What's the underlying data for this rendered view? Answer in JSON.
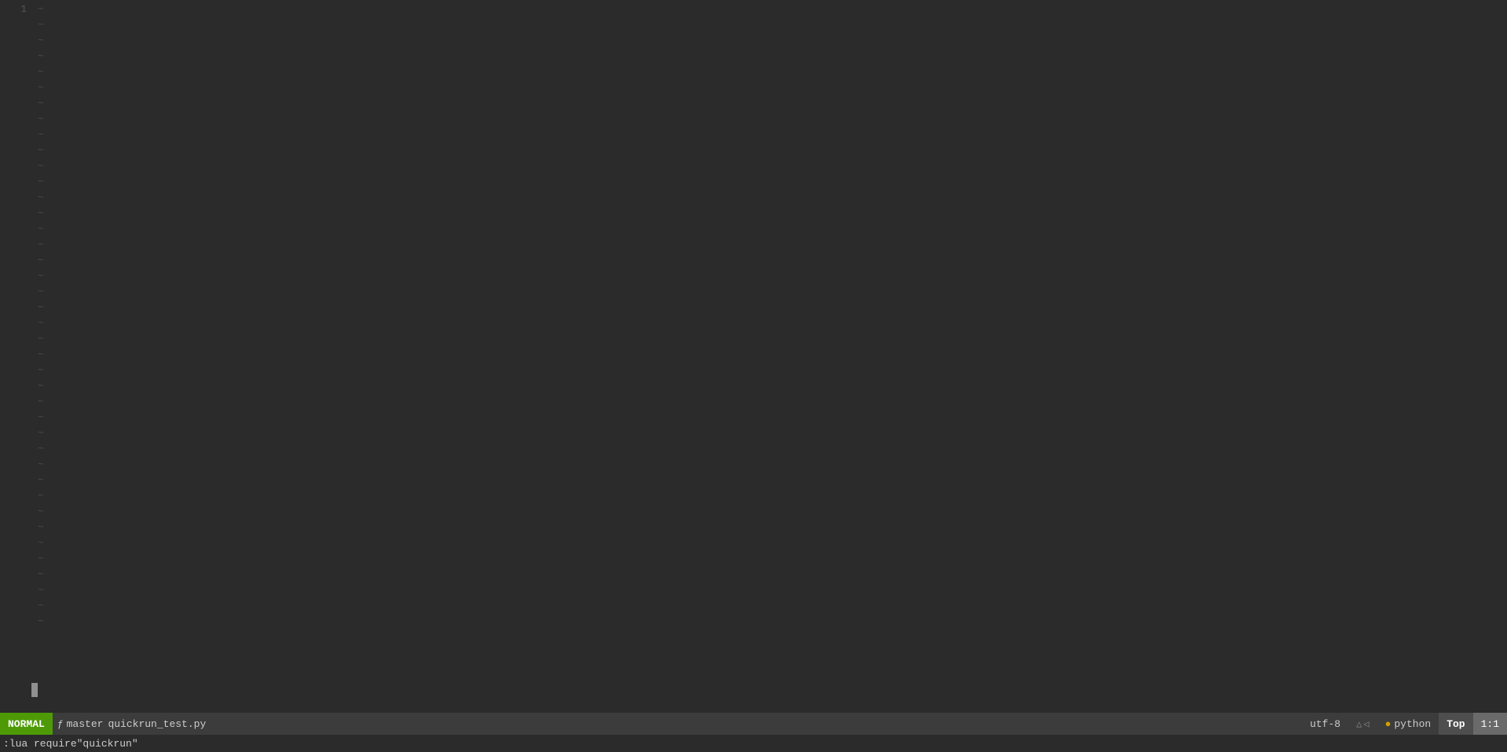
{
  "editor": {
    "background": "#2b2b2b",
    "line_count": 1,
    "tilde_count": 40,
    "content_lines": [],
    "tilde_char": "~"
  },
  "status_bar": {
    "mode": "NORMAL",
    "git_branch_icon": "ƒ",
    "git_branch": "master",
    "filename": "quickrun_test.py",
    "encoding": "utf-8",
    "diff_down_icon": "△",
    "diff_left_icon": "◁",
    "filetype_icon": "●",
    "filetype": "python",
    "position": "Top",
    "line_col": "1:1"
  },
  "command_line": {
    "text": ":lua require\"quickrun\""
  }
}
